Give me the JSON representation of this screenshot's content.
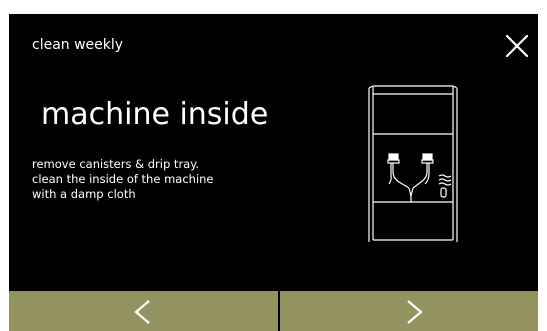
{
  "header": {
    "title": "clean weekly",
    "close_icon": "close-x-icon"
  },
  "main": {
    "heading": "machine inside",
    "instructions": [
      "remove canisters & drip tray.",
      "clean the inside of the machine",
      "with a damp cloth"
    ],
    "illustration_icon": "machine-inside-illustration"
  },
  "navigation": {
    "previous_icon": "chevron-left-icon",
    "next_icon": "chevron-right-icon"
  },
  "colors": {
    "panel_background": "#000000",
    "nav_button": "#93935f",
    "text": "#ffffff",
    "outer_background": "#ffffff"
  }
}
